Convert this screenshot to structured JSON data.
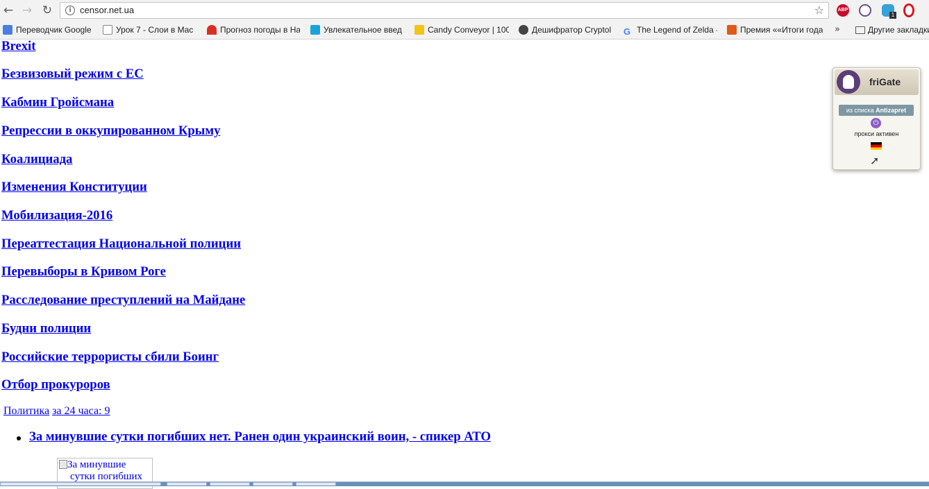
{
  "browser": {
    "url": "censor.net.ua",
    "bookmarks": [
      {
        "label": "Переводчик Google",
        "favicon_color": "#4a7fe0"
      },
      {
        "label": "Урок 7 - Слои в Mac",
        "favicon_color": "#ffffff"
      },
      {
        "label": "Прогноз погоды в На",
        "favicon_color": "#d93025"
      },
      {
        "label": "Увлекательное введ",
        "favicon_color": "#1aa3d9"
      },
      {
        "label": "Candy Conveyor | 100",
        "favicon_color": "#f0c419"
      },
      {
        "label": "Дешифратор Cryptol",
        "favicon_color": "#444444"
      },
      {
        "label": "The Legend of Zelda -",
        "favicon_color": "#4285f4"
      },
      {
        "label": "Премия ««Итоги года",
        "favicon_color": "#e05a1a"
      }
    ],
    "bookmarks_overflow": "»",
    "other_bookmarks": "Другие закладки",
    "extension_badge": "1",
    "extensions": [
      "abp-icon",
      "frigate-icon",
      "ghostery-icon",
      "opera-vpn-icon"
    ]
  },
  "topics": [
    "Brexit",
    "Безвизовый режим с ЕС",
    "Кабмин Гройсмана",
    "Репрессии в оккупированном Крыму",
    "Коалициада",
    "Изменения Конституции",
    "Мобилизация-2016",
    "Переаттестация Национальной полиции",
    "Перевыборы в Кривом Роге",
    "Расследование преступлений на Майдане",
    "Будни полиции",
    "Российские террористы сбили Боинг",
    "Отбор прокуроров"
  ],
  "category": {
    "rubric": "Политика",
    "count_link": "за 24 часа: 9"
  },
  "news": {
    "headline": "За минувшие сутки погибших нет. Ранен один украинский воин, - спикер АТО",
    "image_alt": "За минувшие сутки погибших"
  },
  "frigate": {
    "title": "friGate",
    "list_prefix": "из списка",
    "list_name": "Antizapret",
    "status": "прокси активен",
    "country_flag": "germany-flag-icon"
  }
}
